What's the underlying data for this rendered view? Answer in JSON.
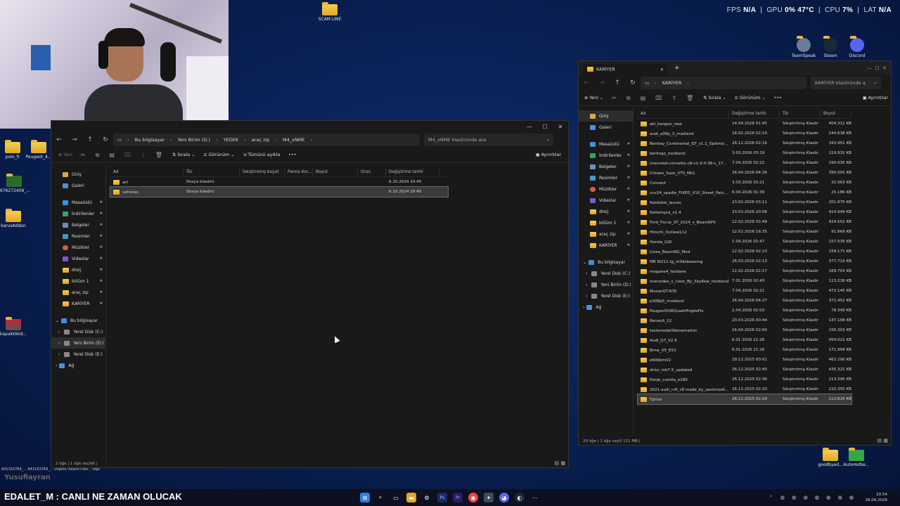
{
  "hud": {
    "fps_label": "FPS",
    "fps": "N/A",
    "gpu_label": "GPU",
    "gpu_pct": "0%",
    "gpu_temp": "47°C",
    "cpu_label": "CPU",
    "cpu_pct": "7%",
    "lat_label": "LAT",
    "lat": "N/A"
  },
  "desktop": {
    "icons_left": [
      {
        "label": "polo_fr"
      },
      {
        "label": "Peugeot_4..."
      },
      {
        "label": "676272409_..."
      },
      {
        "label": "karusAddon"
      },
      {
        "label": "kapakkkkd..."
      }
    ],
    "scam_line": "SCAM LINE",
    "top_right_icons": [
      {
        "label": "TeamSpeak"
      },
      {
        "label": "Steam"
      },
      {
        "label": "Discord"
      }
    ],
    "bottom_right_icons": [
      {
        "label": "goodbyed..."
      },
      {
        "label": "AutoHotke..."
      }
    ],
    "bottom_left_labels": [
      "641163769_...",
      "641163769_...",
      "U6pfeO",
      "86ec67ce4...",
      "logo"
    ],
    "stream_user": "Yusufiayran",
    "banner": "EDALET_M : CANLI NE ZAMAN OLUCAK"
  },
  "left_window": {
    "breadcrumbs": [
      "Bu bilgisayar",
      "Yeni Birim (D:)",
      "YEDEK",
      "araç zip",
      "M4_xNME"
    ],
    "search_placeholder": "M4_xNME klasöründe ara",
    "toolbar": {
      "new": "Yeni",
      "sort": "Sırala",
      "view": "Görünüm",
      "extract": "Tümünü ayıkla",
      "more": "•••",
      "details": "Ayrıntılar"
    },
    "nav": {
      "home": "Giriş",
      "gallery": "Galeri",
      "pinned": [
        "Masaüstü",
        "İndirilenler",
        "Belgeler",
        "Resimler",
        "Müzikler",
        "Videolar",
        "dreij",
        "bölüm 1",
        "araç zip",
        "KARİYER"
      ],
      "this_pc": "Bu bilgisayar",
      "drives": [
        "Yerel Disk (C:)",
        "Yeni Birim (D:)",
        "Yerel Disk (E:)"
      ],
      "network": "Ağ"
    },
    "columns": [
      "Ad",
      "Tür",
      "Sıkıştırılmış boyut",
      "Parola Kor...",
      "Boyut",
      "Oran",
      "Değiştirme tarihi"
    ],
    "rows": [
      {
        "name": "art",
        "type": "Dosya klasörü",
        "date": "6.10.2024 10:45"
      },
      {
        "name": "vehicles",
        "type": "Dosya klasörü",
        "date": "6.10.2024 10:45"
      }
    ],
    "status": "2 öğe  |  1 öğe seçildi  |"
  },
  "right_window": {
    "tab_title": "KARİYER",
    "breadcrumbs": [
      "KARİYER"
    ],
    "search_placeholder": "KARİYER klasöründe a",
    "toolbar": {
      "new": "Yeni",
      "sort": "Sırala",
      "view": "Görünüm",
      "more": "•••",
      "details": "Ayrıntılar"
    },
    "nav": {
      "home": "Giriş",
      "gallery": "Galeri",
      "pinned": [
        "Masaüstü",
        "İndirilenler",
        "Belgeler",
        "Resimler",
        "Müzikler",
        "Videolar",
        "dreij",
        "bölüm 1",
        "araç zip",
        "KARİYER"
      ],
      "this_pc": "Bu bilgisayar",
      "drives": [
        "Yerel Disk (C:)",
        "Yeni Birim (D:)",
        "Yerel Disk (E:)"
      ],
      "network": "Ağ"
    },
    "columns": [
      "Ad",
      "Değiştirme tarihi",
      "Tür",
      "Boyut"
    ],
    "rows": [
      {
        "name": "aki_kangoo_new",
        "date": "14.04.2026 01:45",
        "type": "Sıkıştırılmış Klasör",
        "size": "404.311 KB"
      },
      {
        "name": "audi_a38p_3_modland",
        "date": "18.02.2026 02:19",
        "type": "Sıkıştırılmış Klasör",
        "size": "244.638 KB"
      },
      {
        "name": "Bentley_Continental_GT_v1.1_Optimized_...",
        "date": "26.12.2026 02:16",
        "type": "Sıkıştırılmış Klasör",
        "size": "343.951 KB"
      },
      {
        "name": "berlingo_modland",
        "date": "3.03.2026 03:19",
        "type": "Sıkıştırılmış Klasör",
        "size": "219.932 KB"
      },
      {
        "name": "chevrolet-corvette-c8-v1-3-0-38-v_17688...",
        "date": "7.04.2026 02:22",
        "type": "Sıkıştırılmış Klasör",
        "size": "290.635 KB"
      },
      {
        "name": "Citroen_Saxo_VTS_Mk1",
        "date": "26.04.2026 04:26",
        "type": "Sıkıştırılmış Klasör",
        "size": "390.005 KB"
      },
      {
        "name": "Connect",
        "date": "3.03.2026 03:21",
        "type": "Sıkıştırılmış Klasör",
        "size": "32.963 KB"
      },
      {
        "name": "cnv24_spadie_FIXED_V10_Street_Patch_v1...",
        "date": "6.04.2026 01:39",
        "type": "Sıkıştırılmış Klasör",
        "size": "25.186 KB"
      },
      {
        "name": "fiatdoblo_lauras",
        "date": "23.02.2026 03:11",
        "type": "Sıkıştırılmış Klasör",
        "size": "201.875 KB"
      },
      {
        "name": "fiattempra_v1.4",
        "date": "23.03.2026 20:08",
        "type": "Sıkıştırılmış Klasör",
        "size": "414.949 KB"
      },
      {
        "name": "Ford_Focus_ST_2024_x_BeamRPX",
        "date": "12.02.2026 02:49",
        "type": "Sıkıştırılmış Klasör",
        "size": "424.502 KB"
      },
      {
        "name": "Hirochi_Outlaw112",
        "date": "12.02.2026 16:35",
        "type": "Sıkıştırılmış Klasör",
        "size": "91.869 KB"
      },
      {
        "name": "Honda_S2K",
        "date": "1.04.2026 02:47",
        "type": "Sıkıştırılmış Klasör",
        "size": "157.539 KB"
      },
      {
        "name": "Linea_BeamNG_Mod",
        "date": "12.02.2026 02:23",
        "type": "Sıkıştırılmış Klasör",
        "size": "159.171 KB"
      },
      {
        "name": "MB W211 tg_m0dsbeamng",
        "date": "26.03.2026 02:13",
        "type": "Sıkıştırılmış Klasör",
        "size": "377.714 KB"
      },
      {
        "name": "megane4_fastlane",
        "date": "12.02.2026 02:17",
        "type": "Sıkıştırılmış Klasör",
        "size": "169.703 KB"
      },
      {
        "name": "mercedes_x_class_By_ZeyKow_modland",
        "date": "7.01.2026 02:43",
        "type": "Sıkıştırılmış Klasör",
        "size": "113.236 KB"
      },
      {
        "name": "NissanGT-R35",
        "date": "7.04.2026 02:21",
        "type": "Sıkıştırılmış Klasör",
        "size": "472.145 KB"
      },
      {
        "name": "p308p5_modland",
        "date": "26.04.2026 04:27",
        "type": "Sıkıştırılmış Klasör",
        "size": "372.452 KB"
      },
      {
        "name": "Peugeot508QuadriFoglioFix",
        "date": "2.04.2026 02:03",
        "type": "Sıkıştırılmış Klasör",
        "size": "78.349 KB"
      },
      {
        "name": "Renault_12",
        "date": "23.03.2026 00:44",
        "type": "Sıkıştırılmış Klasör",
        "size": "147.108 KB"
      },
      {
        "name": "teslamodel3kenemation",
        "date": "16.04.2026 02:04",
        "type": "Sıkıştırılmış Klasör",
        "size": "156.303 KB"
      },
      {
        "name": "Audi_Q7_V2.6",
        "date": "6.01.2026 21:26",
        "type": "Sıkıştırılmış Klasör",
        "size": "454.022 KB"
      },
      {
        "name": "Bmw_X5_E53",
        "date": "6.01.2026 21:16",
        "type": "Sıkıştırılmış Klasör",
        "size": "171.994 KB"
      },
      {
        "name": "e60bbmV2",
        "date": "29.12.2025 00:01",
        "type": "Sıkıştırılmış Klasör",
        "size": "462.290 KB"
      },
      {
        "name": "zhisz_mk7.5_updated",
        "date": "26.12.2025 02:40",
        "type": "Sıkıştırılmış Klasör",
        "size": "435.321 KB"
      },
      {
        "name": "flanje_corolla_e180",
        "date": "26.12.2025 02:36",
        "type": "Sıkıştırılmış Klasör",
        "size": "213.395 KB"
      },
      {
        "name": "2021 audi_rs6_c8 made_by_savior(edit) v1...",
        "date": "26.12.2025 02:33",
        "type": "Sıkıştırılmış Klasör",
        "size": "210.350 KB"
      },
      {
        "name": "Tprius",
        "date": "26.12.2025 02:29",
        "type": "Sıkıştırılmış Klasör",
        "size": "113.820 KB"
      }
    ],
    "status": "29 öğe  |  1 öğe seçili 111 MB  |"
  },
  "clock": {
    "time": "20:54",
    "date": "28.04.2026"
  }
}
